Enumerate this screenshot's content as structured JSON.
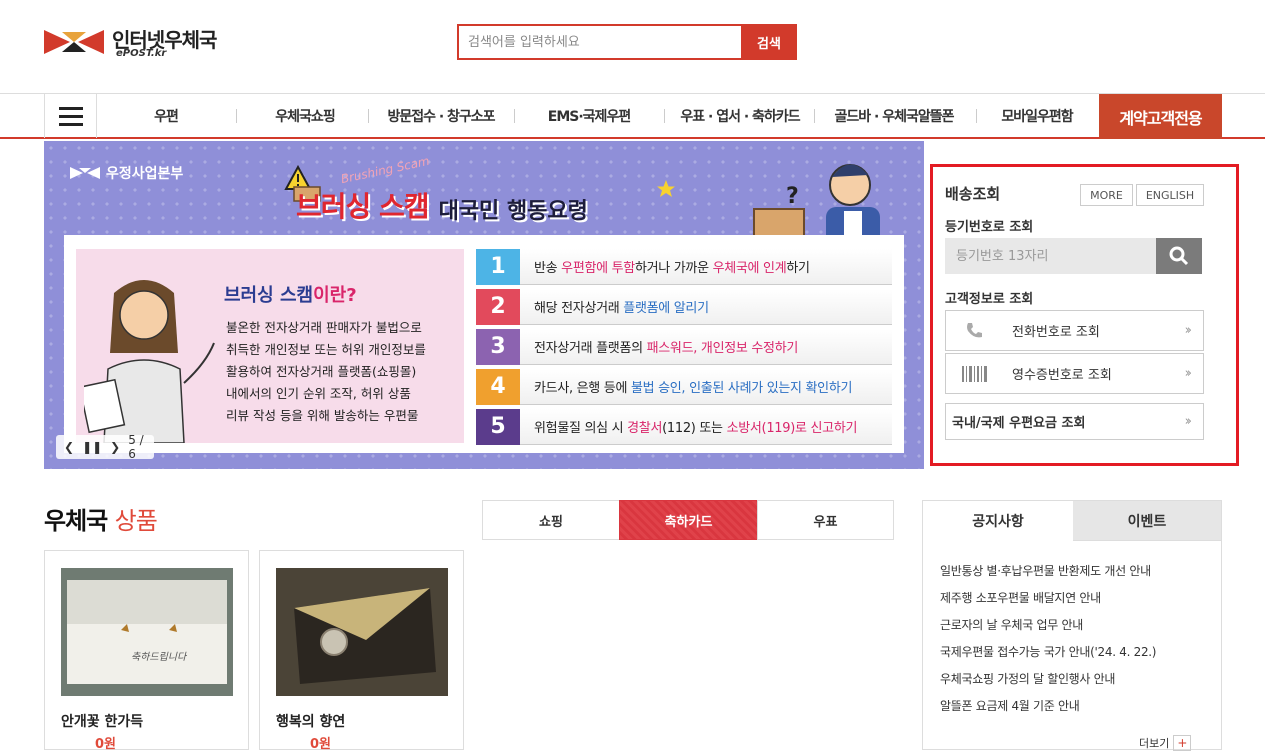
{
  "header": {
    "logo_title": "인터넷우체국",
    "logo_sub": "ePOST.kr",
    "search_placeholder": "검색어를 입력하세요",
    "search_button": "검색"
  },
  "nav": {
    "items": [
      "우편",
      "우체국쇼핑",
      "방문접수 · 창구소포",
      "EMS·국제우편",
      "우표 · 엽서 · 축하카드",
      "골드바 · 우체국알뜰폰",
      "모바일우편함"
    ],
    "highlight": "계약고객전용"
  },
  "banner": {
    "org": "우정사업본부",
    "title_en": "Brushing Scam",
    "title_main": "브러싱 스캠",
    "title_sub": "대국민 행동요령",
    "left_title_a": "브러싱 스캠",
    "left_title_b": "이란?",
    "left_text": "불온한 전자상거래 판매자가 불법으로\n취득한 개인정보 또는 허위 개인정보를\n활용하여 전자상거래 플랫폼(쇼핑몰)\n내에서의 인기 순위 조작, 허위 상품\n리뷰 작성 등을 위해 발송하는 우편물",
    "steps": [
      {
        "num": "1",
        "a": "반송 ",
        "b": "우편함에 투함",
        "c": "하거나 가까운 ",
        "d": "우체국에 인계",
        "e": "하기"
      },
      {
        "num": "2",
        "a": "해당 전자상거래 ",
        "b": "",
        "c": "",
        "d": "플랫폼에 알리기",
        "e": ""
      },
      {
        "num": "3",
        "a": "전자상거래 플랫폼의 ",
        "b": "패스워드, 개인정보 수정하기",
        "c": "",
        "d": "",
        "e": ""
      },
      {
        "num": "4",
        "a": "카드사, 은행 등에 ",
        "b": "",
        "c": "",
        "d": "불법 승인, 인출된 사례가 있는지 확인하기",
        "e": ""
      },
      {
        "num": "5",
        "a": "위험물질 의심 시 ",
        "b": "경찰서",
        "c": "(112) 또는 ",
        "d": "소방서",
        "e": "(119)로 신고하기"
      }
    ],
    "counter": "5 / 6"
  },
  "delivery": {
    "title": "배송조회",
    "more": "MORE",
    "english": "ENGLISH",
    "reg_label": "등기번호로 조회",
    "reg_placeholder": "등기번호 13자리",
    "customer_label": "고객정보로 조회",
    "phone_query": "전화번호로 조회",
    "receipt_query": "영수증번호로 조회",
    "rate_query": "국내/국제 우편요금 조회"
  },
  "products": {
    "title_a": "우체국",
    "title_b": "상품",
    "tabs": [
      "쇼핑",
      "축하카드",
      "우표"
    ],
    "cards": [
      {
        "name": "안개꽃 한가득",
        "price": "0원"
      },
      {
        "name": "행복의 향연",
        "price": "0원"
      }
    ]
  },
  "notice": {
    "tabs": [
      "공지사항",
      "이벤트"
    ],
    "items": [
      "일반통상 별·후납우편물 반환제도 개선 안내",
      "제주행 소포우편물 배달지연 안내",
      "근로자의 날 우체국 업무 안내",
      "국제우편물 접수가능 국가 안내('24. 4. 22.)",
      "우체국쇼핑 가정의 달 할인행사 안내",
      "알뜰폰 요금제 4월 기준 안내"
    ],
    "more": "더보기"
  },
  "colors": {
    "brand_red": "#d23a2b",
    "vip": "#c9472b",
    "highlight_box": "#e31b23"
  }
}
